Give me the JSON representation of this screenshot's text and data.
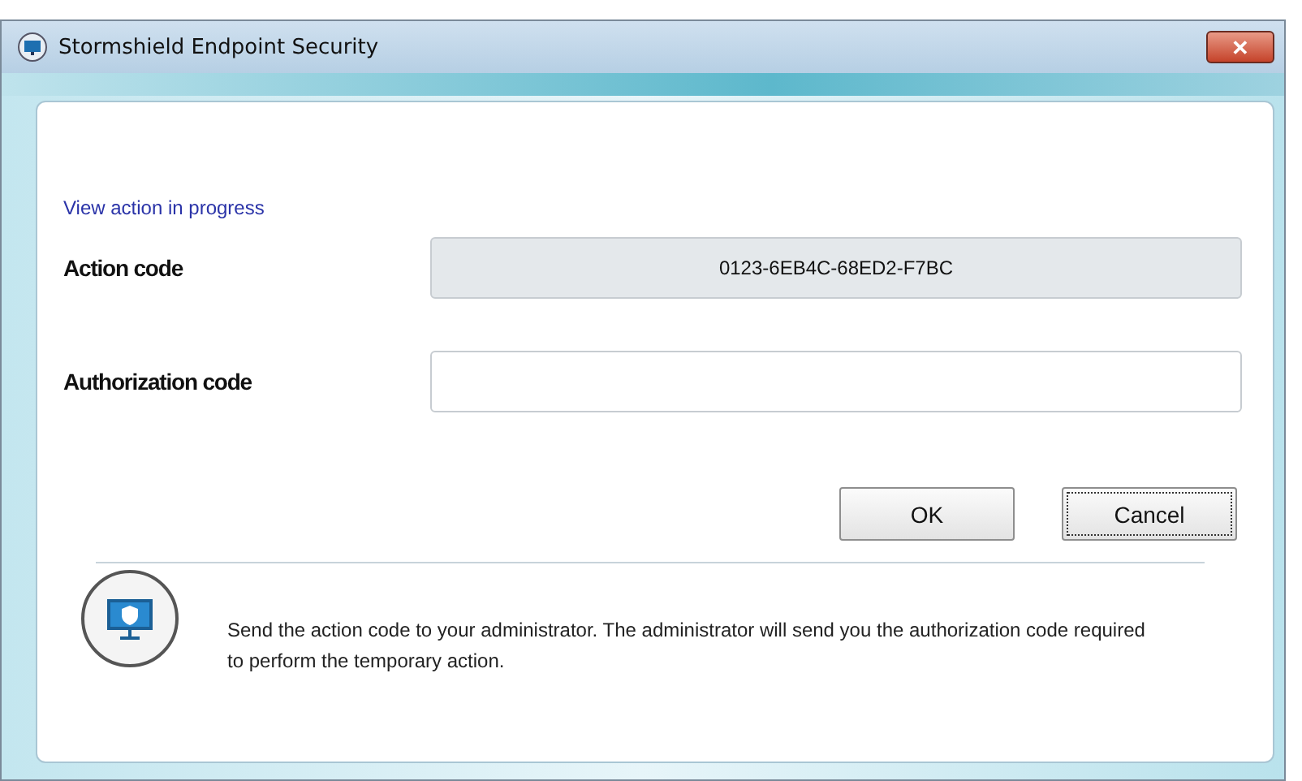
{
  "window": {
    "title": "Stormshield Endpoint Security",
    "close": "✕"
  },
  "link": "View action in progress",
  "fields": [
    {
      "label": "Action code",
      "value": "0123-6EB4C-68ED2-F7BC",
      "disabled": true
    },
    {
      "label": "Authorization code",
      "disabled": false
    }
  ],
  "buttons": [
    {
      "label": "OK",
      "focused": false
    },
    {
      "label": "Cancel",
      "focused": true
    }
  ],
  "info": "Send the action code to your administrator. The administrator will send you the authorization code required to perform the temporary action."
}
